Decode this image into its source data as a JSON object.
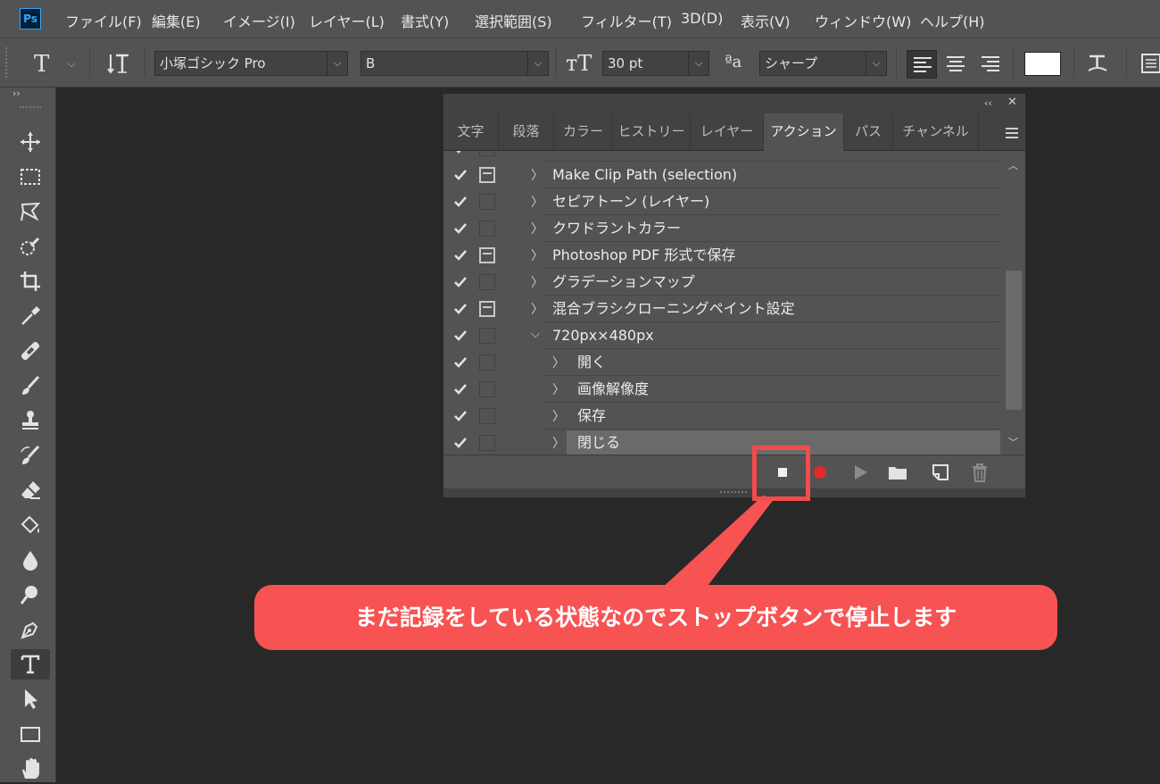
{
  "app": {
    "logo": "Ps"
  },
  "menu": [
    "ファイル(F)",
    "編集(E)",
    "イメージ(I)",
    "レイヤー(L)",
    "書式(Y)",
    "選択範囲(S)",
    "フィルター(T)",
    "3D(D)",
    "表示(V)",
    "ウィンドウ(W)",
    "ヘルプ(H)"
  ],
  "options": {
    "font_family": "小塚ゴシック Pro",
    "font_style": "B",
    "font_size": "30 pt",
    "antialias": "シャープ",
    "aa_icon": "ªa",
    "text_color": "#ffffff"
  },
  "panel": {
    "tabs": [
      "文字",
      "段落",
      "カラー",
      "ヒストリー",
      "レイヤー",
      "アクション",
      "パス",
      "チャンネル"
    ],
    "active_tab": "アクション",
    "actions": [
      {
        "label": "Make Clip Path (selection)",
        "dialog": true,
        "expanded": false,
        "indent": 0
      },
      {
        "label": "セピアトーン (レイヤー)",
        "dialog": false,
        "expanded": false,
        "indent": 0
      },
      {
        "label": "クワドラントカラー",
        "dialog": false,
        "expanded": false,
        "indent": 0
      },
      {
        "label": "Photoshop PDF 形式で保存",
        "dialog": true,
        "expanded": false,
        "indent": 0
      },
      {
        "label": "グラデーションマップ",
        "dialog": false,
        "expanded": false,
        "indent": 0
      },
      {
        "label": "混合ブラシクローニングペイント設定",
        "dialog": true,
        "expanded": false,
        "indent": 0
      },
      {
        "label": "720px×480px",
        "dialog": false,
        "expanded": true,
        "indent": 0
      },
      {
        "label": "開く",
        "dialog": false,
        "expanded": false,
        "indent": 1
      },
      {
        "label": "画像解像度",
        "dialog": false,
        "expanded": false,
        "indent": 1
      },
      {
        "label": "保存",
        "dialog": false,
        "expanded": false,
        "indent": 1
      },
      {
        "label": "閉じる",
        "dialog": false,
        "expanded": false,
        "indent": 1,
        "selected": true
      }
    ]
  },
  "callout": {
    "text": "まだ記録をしている状態なのでストップボタンで停止します",
    "color": "#f75353"
  },
  "icons": {
    "footer": [
      "stop-icon",
      "record-icon",
      "play-icon",
      "folder-icon",
      "new-action-icon",
      "trash-icon"
    ]
  }
}
